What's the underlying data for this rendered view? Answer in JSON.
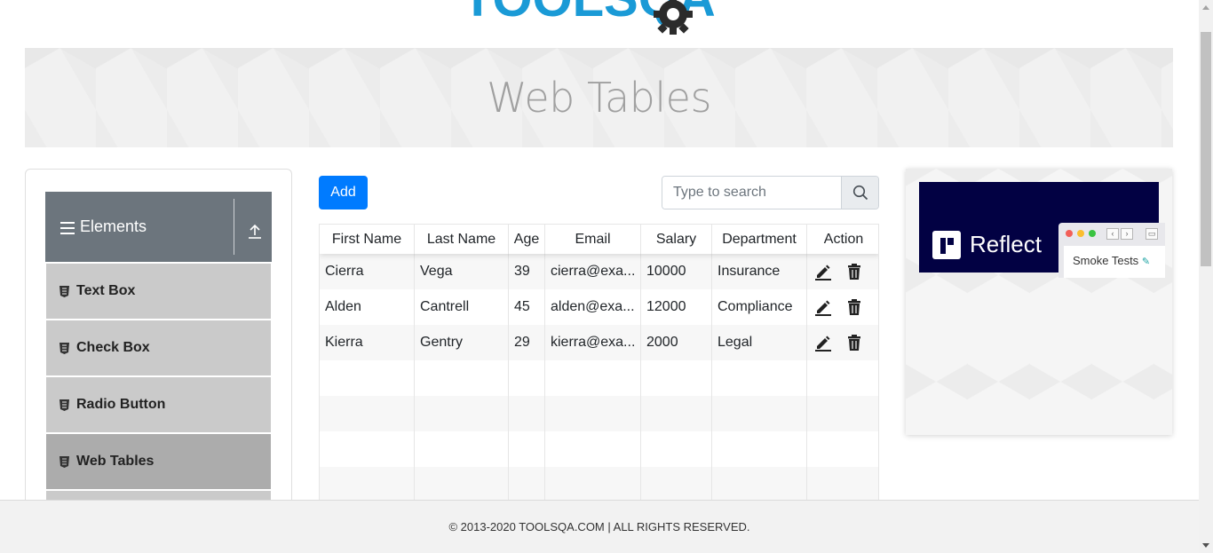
{
  "logo": {
    "text": "TOOLSQA",
    "color": "#1a9ad6"
  },
  "banner": {
    "title": "Web Tables"
  },
  "sidebar": {
    "group": {
      "title": "Elements",
      "icons": [
        "menu-icon",
        "collapse-up-icon"
      ]
    },
    "items": [
      {
        "label": "Text Box",
        "icon": "html5-icon",
        "active": false
      },
      {
        "label": "Check Box",
        "icon": "html5-icon",
        "active": false
      },
      {
        "label": "Radio Button",
        "icon": "html5-icon",
        "active": false
      },
      {
        "label": "Web Tables",
        "icon": "html5-icon",
        "active": true
      }
    ]
  },
  "toolbar": {
    "add_label": "Add",
    "search_placeholder": "Type to search",
    "search_icon": "search-icon"
  },
  "table": {
    "headers": [
      "First Name",
      "Last Name",
      "Age",
      "Email",
      "Salary",
      "Department",
      "Action"
    ],
    "rows": [
      {
        "first": "Cierra",
        "last": "Vega",
        "age": "39",
        "email": "cierra@exa...",
        "salary": "10000",
        "department": "Insurance"
      },
      {
        "first": "Alden",
        "last": "Cantrell",
        "age": "45",
        "email": "alden@exa...",
        "salary": "12000",
        "department": "Compliance"
      },
      {
        "first": "Kierra",
        "last": "Gentry",
        "age": "29",
        "email": "kierra@exa...",
        "salary": "2000",
        "department": "Legal"
      }
    ],
    "action_icons": [
      "edit-icon",
      "delete-icon"
    ]
  },
  "ad": {
    "brand": "Reflect",
    "card_text": "Smoke Tests",
    "accent": "#020143"
  },
  "footer": {
    "text": "© 2013-2020 TOOLSQA.COM | ALL RIGHTS RESERVED."
  },
  "colors": {
    "primary": "#007bff",
    "group_header": "#6c757d",
    "menu_item": "#cacaca",
    "menu_item_active": "#acacac"
  }
}
